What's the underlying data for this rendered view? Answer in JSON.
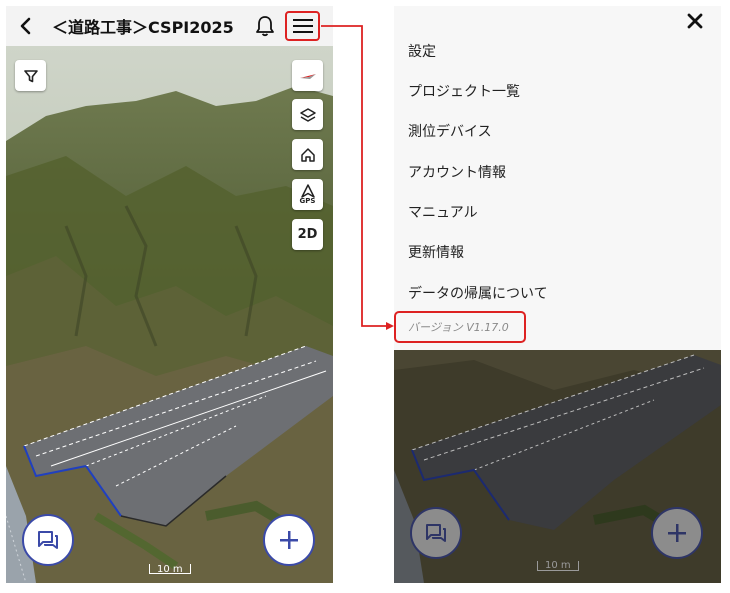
{
  "left_screen": {
    "header": {
      "title": "＜道路工事＞CSPI2025",
      "back_icon": "chevron-left-icon",
      "notification_icon": "bell-icon",
      "menu_icon": "hamburger-menu-icon"
    },
    "map_tools": {
      "filter_icon": "filter-icon",
      "compass_icon": "compass-icon",
      "layers_icon": "layers-icon",
      "home_icon": "home-icon",
      "gps_label": "GPS",
      "view_mode_label": "2D"
    },
    "scale_label": "10 m",
    "fab_left_icon": "chat-icon",
    "fab_right_icon": "plus-icon"
  },
  "right_screen": {
    "close_icon": "close-icon",
    "menu_items": [
      "設定",
      "プロジェクト一覧",
      "測位デバイス",
      "アカウント情報",
      "マニュアル",
      "更新情報",
      "データの帰属について"
    ],
    "version_text": "バージョン V1.17.0",
    "scale_label": "10 m"
  },
  "colors": {
    "highlight": "#dd2222",
    "fab_border": "#3b4aa8",
    "header_bg": "#f3f3f3",
    "menu_bg": "#f7f7f7"
  }
}
